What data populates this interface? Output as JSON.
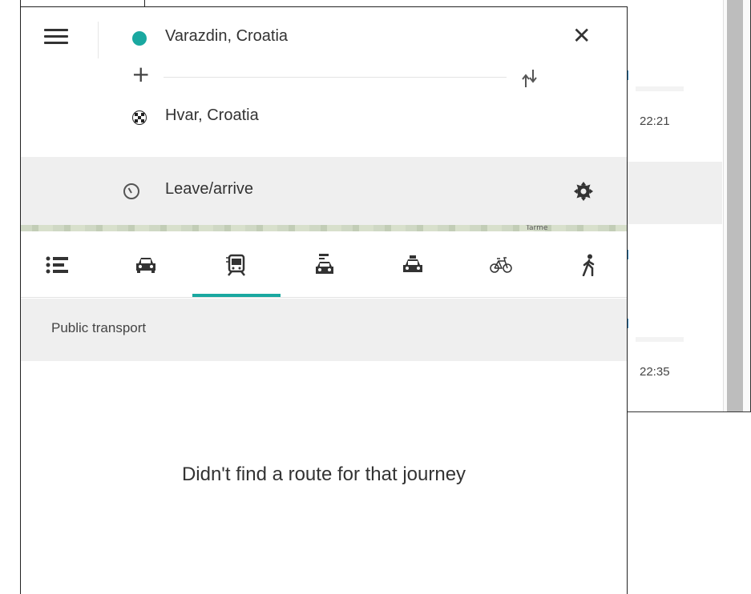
{
  "route": {
    "origin": "Varazdin, Croatia",
    "destination": "Hvar, Croatia",
    "time_option": "Leave/arrive"
  },
  "map": {
    "partial_label": "Tarme"
  },
  "background_list": {
    "times": [
      "22:21",
      "22:35"
    ]
  },
  "modes": [
    {
      "name": "overview",
      "icon": "list-icon"
    },
    {
      "name": "car",
      "icon": "car-icon"
    },
    {
      "name": "public-transport",
      "icon": "train-icon",
      "selected": true
    },
    {
      "name": "car-share",
      "icon": "car-share-icon"
    },
    {
      "name": "taxi",
      "icon": "taxi-icon"
    },
    {
      "name": "bike",
      "icon": "bike-icon"
    },
    {
      "name": "walk",
      "icon": "walk-icon"
    }
  ],
  "results": {
    "category": "Public transport",
    "empty_message": "Didn't find a route for that journey"
  },
  "colors": {
    "accent": "#1aa8a0",
    "panel_gray": "#efefef",
    "text": "#333333"
  }
}
